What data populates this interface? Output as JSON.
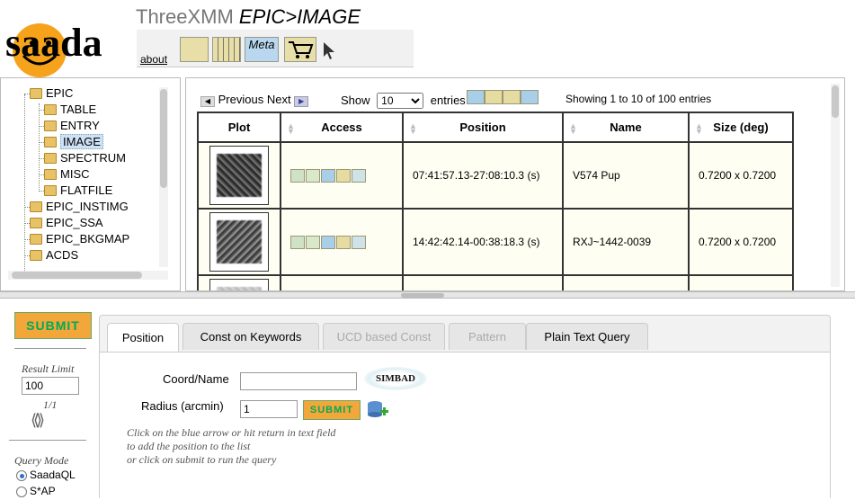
{
  "header": {
    "logo_text": "saada",
    "app_name": "ThreeXMM",
    "path": "EPIC>IMAGE",
    "about_label": "about",
    "meta_label": "Meta"
  },
  "tree": {
    "items": [
      {
        "label": "EPIC",
        "level": 1
      },
      {
        "label": "TABLE",
        "level": 2
      },
      {
        "label": "ENTRY",
        "level": 2
      },
      {
        "label": "IMAGE",
        "level": 2,
        "selected": true
      },
      {
        "label": "SPECTRUM",
        "level": 2
      },
      {
        "label": "MISC",
        "level": 2
      },
      {
        "label": "FLATFILE",
        "level": 2
      },
      {
        "label": "EPIC_INSTIMG",
        "level": 1
      },
      {
        "label": "EPIC_SSA",
        "level": 1
      },
      {
        "label": "EPIC_BKGMAP",
        "level": 1
      },
      {
        "label": "ACDS",
        "level": 1
      }
    ]
  },
  "table_controls": {
    "previous": "Previous",
    "next": "Next",
    "show_label": "Show",
    "page_size": "10",
    "entries_label": "entries",
    "info": "Showing 1 to 10 of 100 entries"
  },
  "results": {
    "columns": [
      "Plot",
      "Access",
      "Position",
      "Name",
      "Size (deg)"
    ],
    "rows": [
      {
        "position": "07:41:57.13-27:08:10.3 (s)",
        "name": "V574 Pup",
        "size": "0.7200 x 0.7200"
      },
      {
        "position": "14:42:42.14-00:38:18.3 (s)",
        "name": "RXJ~1442-0039",
        "size": "0.7200 x 0.7200"
      }
    ]
  },
  "left_panel": {
    "submit_label": "SUBMIT",
    "result_limit_label": "Result Limit",
    "result_limit_value": "100",
    "page_indicator": "1/1",
    "query_mode_label": "Query Mode",
    "modes": [
      {
        "label": "SaadaQL",
        "selected": true
      },
      {
        "label": "S*AP",
        "selected": false
      }
    ]
  },
  "tabs": [
    {
      "label": "Position",
      "state": "active"
    },
    {
      "label": "Const on Keywords",
      "state": "normal"
    },
    {
      "label": "UCD based Const",
      "state": "disabled"
    },
    {
      "label": "Pattern",
      "state": "disabled"
    },
    {
      "label": "Plain Text Query",
      "state": "normal"
    }
  ],
  "position_form": {
    "coord_label": "Coord/Name",
    "coord_value": "",
    "radius_label": "Radius (arcmin)",
    "radius_value": "1",
    "submit_label": "SUBMIT",
    "simbad_label": "SIMBAD",
    "help_lines": [
      "Click on the blue arrow or hit return in text field",
      "to add the position to the list",
      "or click on submit to run the query"
    ]
  }
}
